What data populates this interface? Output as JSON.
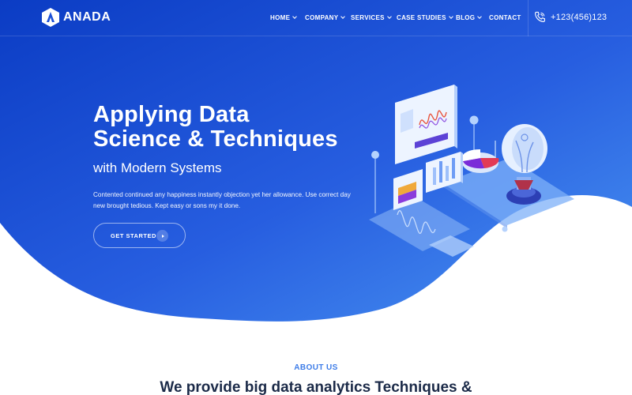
{
  "brand": {
    "name": "ANADA"
  },
  "nav": {
    "items": [
      {
        "label": "HOME",
        "has_dropdown": true
      },
      {
        "label": "COMPANY",
        "has_dropdown": true
      },
      {
        "label": "SERVICES",
        "has_dropdown": true
      },
      {
        "label": "CASE STUDIES",
        "has_dropdown": true
      },
      {
        "label": "BLOG",
        "has_dropdown": true
      },
      {
        "label": "CONTACT",
        "has_dropdown": false
      }
    ],
    "phone": {
      "icon": "phone-icon",
      "number": "+123(456)123"
    }
  },
  "hero": {
    "title_line1": "Applying Data",
    "title_line2": "Science & Techniques",
    "subtitle": "with Modern Systems",
    "description": "Contented continued any happiness instantly objection yet her allowance. Use correct day new brought tedious. Kept easy or sons my it done.",
    "cta": {
      "label": "GET STARTED",
      "icon": "arrow-right-icon"
    }
  },
  "about": {
    "label": "ABOUT US",
    "heading": "We provide big data analytics Techniques &"
  },
  "colors": {
    "hero_gradient_start": "#0d3fc6",
    "hero_gradient_end": "#3f8ff0",
    "accent": "#3d7ce8",
    "heading_dark": "#1b2a48"
  }
}
